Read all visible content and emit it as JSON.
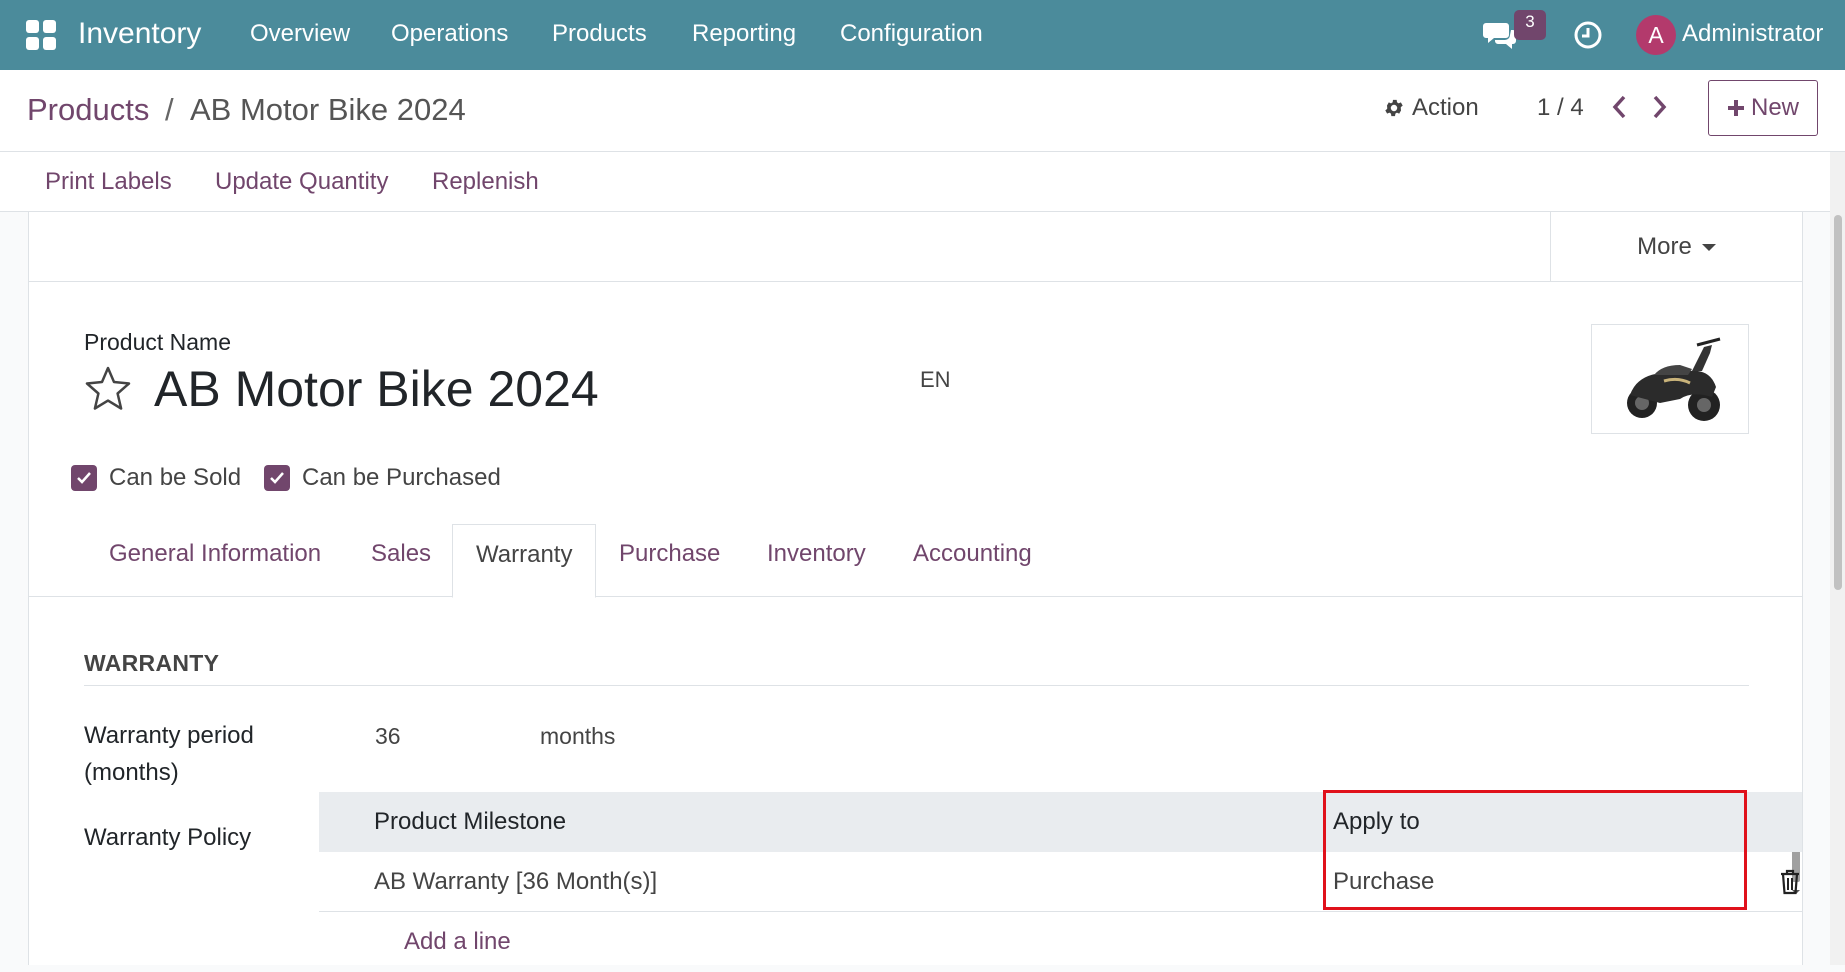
{
  "navbar": {
    "app_name": "Inventory",
    "menu": [
      "Overview",
      "Operations",
      "Products",
      "Reporting",
      "Configuration"
    ],
    "message_count": "3",
    "user_initial": "A",
    "user_name": "Administrator"
  },
  "control_panel": {
    "breadcrumb_parent": "Products",
    "breadcrumb_separator": "/",
    "breadcrumb_current": "AB Motor Bike 2024",
    "action_label": "Action",
    "pager": "1 / 4",
    "new_label": "New"
  },
  "action_bar": [
    "Print Labels",
    "Update Quantity",
    "Replenish"
  ],
  "status": {
    "more_label": "More"
  },
  "product": {
    "name_label": "Product Name",
    "name": "AB Motor Bike 2024",
    "lang": "EN",
    "can_be_sold": "Can be Sold",
    "can_be_purchased": "Can be Purchased"
  },
  "tabs": [
    "General Information",
    "Sales",
    "Warranty",
    "Purchase",
    "Inventory",
    "Accounting"
  ],
  "warranty": {
    "section_title": "WARRANTY",
    "period_label_line1": "Warranty period",
    "period_label_line2": "(months)",
    "period_value": "36",
    "period_unit": "months",
    "policy_label": "Warranty Policy",
    "columns": [
      "Product Milestone",
      "Apply to"
    ],
    "rows": [
      {
        "milestone": "AB Warranty [36 Month(s)]",
        "apply_to": "Purchase"
      }
    ],
    "add_line": "Add a line"
  },
  "colors": {
    "navbar": "#4b8b9b",
    "accent": "#71466c",
    "highlight": "#e0111b"
  }
}
